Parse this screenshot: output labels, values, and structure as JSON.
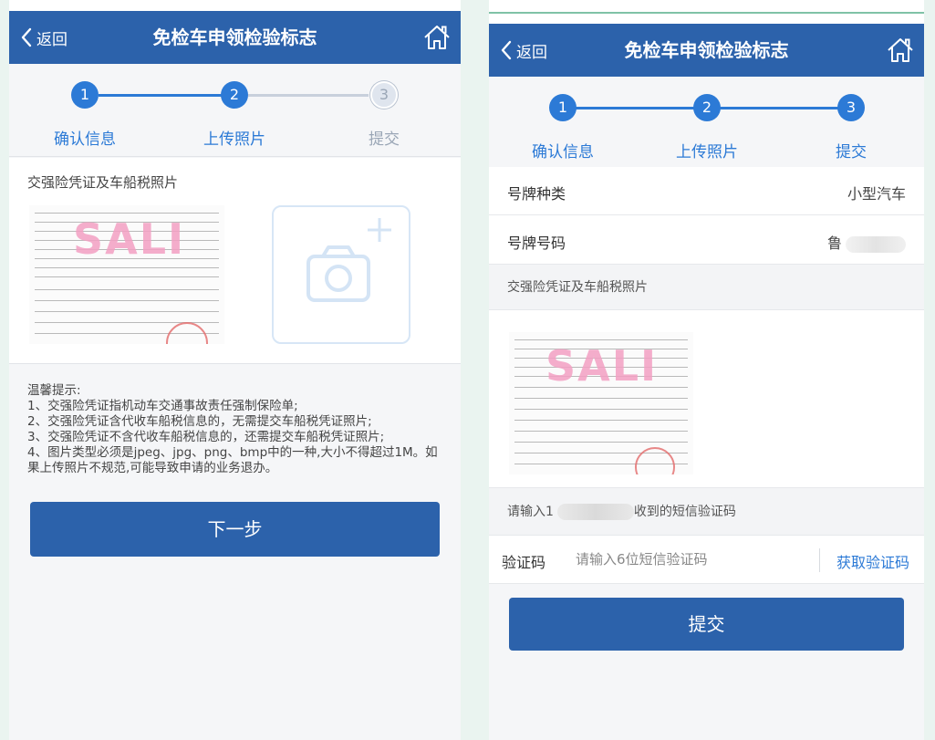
{
  "common": {
    "back_label": "返回",
    "page_title": "免检车申领检验标志",
    "steps": [
      "确认信息",
      "上传照片",
      "提交"
    ],
    "step_numbers": [
      "1",
      "2",
      "3"
    ],
    "header_color": "#2c62ab",
    "accent_color": "#2c7ad6"
  },
  "left": {
    "current_step": 2,
    "photo_section_title": "交强险凭证及车船税照片",
    "receipt_watermark": "SALI",
    "tips": [
      "温馨提示:",
      "1、交强险凭证指机动车交通事故责任强制保险单;",
      "2、交强险凭证含代收车船税信息的，无需提交车船税凭证照片;",
      "3、交强险凭证不含代收车船税信息的，还需提交车船税凭证照片;",
      "4、图片类型必须是jpeg、jpg、png、bmp中的一种,大小不得超过1M。如果上传照片不规范,可能导致申请的业务退办。"
    ],
    "next_button": "下一步"
  },
  "right": {
    "current_step": 3,
    "plate_type_label": "号牌种类",
    "plate_type_value": "小型汽车",
    "plate_number_label": "号牌号码",
    "plate_number_prefix": "鲁",
    "photo_section_title": "交强险凭证及车船税照片",
    "receipt_watermark": "SALI",
    "sms_prompt_prefix": "请输入1",
    "sms_prompt_suffix": "收到的短信验证码",
    "code_label": "验证码",
    "code_placeholder": "请输入6位短信验证码",
    "get_code": "获取验证码",
    "submit_button": "提交"
  }
}
